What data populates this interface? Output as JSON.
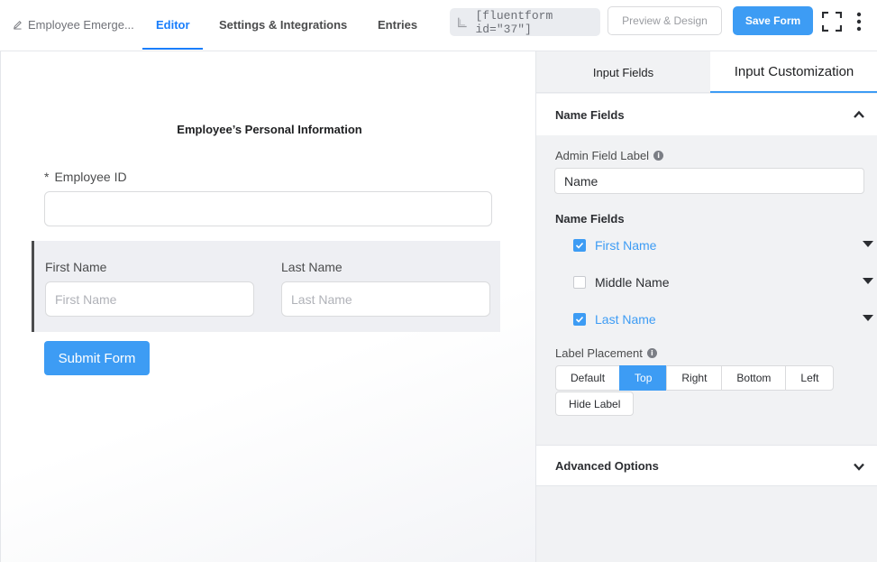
{
  "header": {
    "form_name": "Employee Emerge...",
    "tabs": [
      "Editor",
      "Settings & Integrations",
      "Entries"
    ],
    "shortcode": "[fluentform id=\"37\"]",
    "preview_label": "Preview & Design",
    "save_label": "Save Form"
  },
  "form": {
    "section_title": "Employee’s Personal Information",
    "employee_id_required": "*",
    "employee_id_label": "Employee ID",
    "first_name_label": "First Name",
    "first_name_placeholder": "First Name",
    "last_name_label": "Last Name",
    "last_name_placeholder": "Last Name",
    "submit_label": "Submit Form"
  },
  "panel": {
    "tabs": [
      "Input Fields",
      "Input Customization"
    ],
    "active_tab": "Input Customization",
    "name_fields_title": "Name Fields",
    "admin_label": "Admin Field Label",
    "admin_value": "Name",
    "name_fields_sub": "Name Fields",
    "fields": [
      {
        "label": "First Name",
        "checked": true
      },
      {
        "label": "Middle Name",
        "checked": false
      },
      {
        "label": "Last Name",
        "checked": true
      }
    ],
    "label_placement": "Label Placement",
    "placements": [
      "Default",
      "Top",
      "Right",
      "Bottom",
      "Left"
    ],
    "active_placement": "Top",
    "hide_label": "Hide Label",
    "advanced_options": "Advanced Options"
  },
  "colors": {
    "accent": "#3d9cf4",
    "active_tab": "#1a7efb"
  }
}
